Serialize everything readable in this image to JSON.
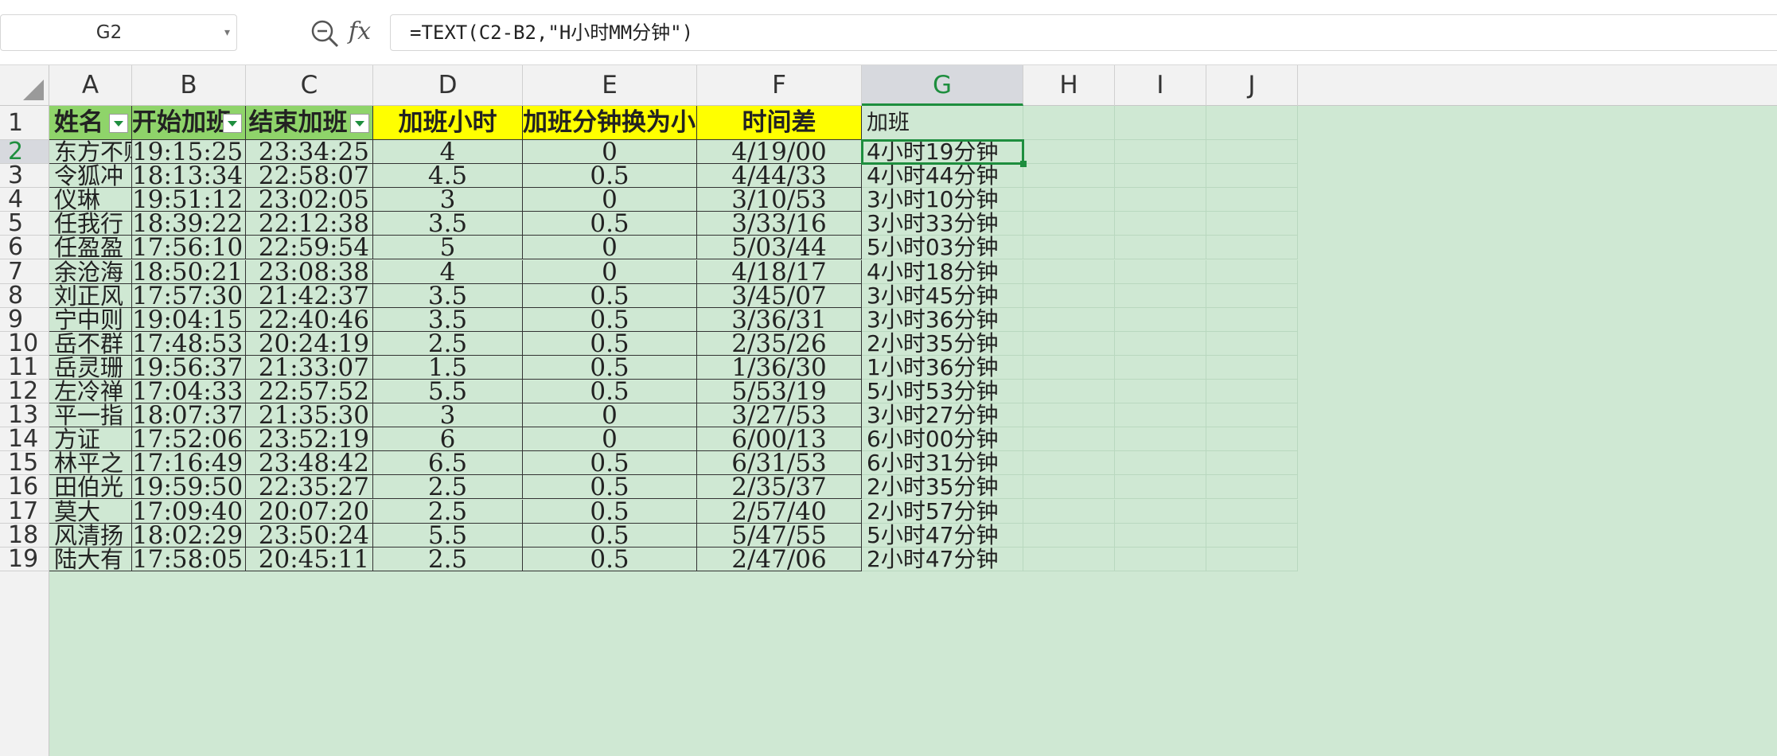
{
  "formula_bar": {
    "cell_ref": "G2",
    "formula": "=TEXT(C2-B2,\"H小时MM分钟\")",
    "zoom_icon": "zoom-out-icon",
    "fx_label": "fx"
  },
  "columns": [
    "A",
    "B",
    "C",
    "D",
    "E",
    "F",
    "G",
    "H",
    "I",
    "J"
  ],
  "active_column": "G",
  "active_row": 2,
  "headers": [
    "姓名",
    "开始加班",
    "结束加班",
    "加班小时",
    "加班分钟换为小时",
    "时间差",
    "加班"
  ],
  "rows": [
    {
      "num": "2",
      "cells": [
        "东方不败",
        "19:15:25",
        "23:34:25",
        "4",
        "0",
        "4/19/00",
        "4小时19分钟"
      ]
    },
    {
      "num": "3",
      "cells": [
        "令狐冲",
        "18:13:34",
        "22:58:07",
        "4.5",
        "0.5",
        "4/44/33",
        "4小时44分钟"
      ]
    },
    {
      "num": "4",
      "cells": [
        "仪琳",
        "19:51:12",
        "23:02:05",
        "3",
        "0",
        "3/10/53",
        "3小时10分钟"
      ]
    },
    {
      "num": "5",
      "cells": [
        "任我行",
        "18:39:22",
        "22:12:38",
        "3.5",
        "0.5",
        "3/33/16",
        "3小时33分钟"
      ]
    },
    {
      "num": "6",
      "cells": [
        "任盈盈",
        "17:56:10",
        "22:59:54",
        "5",
        "0",
        "5/03/44",
        "5小时03分钟"
      ]
    },
    {
      "num": "7",
      "cells": [
        "余沧海",
        "18:50:21",
        "23:08:38",
        "4",
        "0",
        "4/18/17",
        "4小时18分钟"
      ]
    },
    {
      "num": "8",
      "cells": [
        "刘正风",
        "17:57:30",
        "21:42:37",
        "3.5",
        "0.5",
        "3/45/07",
        "3小时45分钟"
      ]
    },
    {
      "num": "9",
      "cells": [
        "宁中则",
        "19:04:15",
        "22:40:46",
        "3.5",
        "0.5",
        "3/36/31",
        "3小时36分钟"
      ]
    },
    {
      "num": "10",
      "cells": [
        "岳不群",
        "17:48:53",
        "20:24:19",
        "2.5",
        "0.5",
        "2/35/26",
        "2小时35分钟"
      ]
    },
    {
      "num": "11",
      "cells": [
        "岳灵珊",
        "19:56:37",
        "21:33:07",
        "1.5",
        "0.5",
        "1/36/30",
        "1小时36分钟"
      ]
    },
    {
      "num": "12",
      "cells": [
        "左冷禅",
        "17:04:33",
        "22:57:52",
        "5.5",
        "0.5",
        "5/53/19",
        "5小时53分钟"
      ]
    },
    {
      "num": "13",
      "cells": [
        "平一指",
        "18:07:37",
        "21:35:30",
        "3",
        "0",
        "3/27/53",
        "3小时27分钟"
      ]
    },
    {
      "num": "14",
      "cells": [
        "方证",
        "17:52:06",
        "23:52:19",
        "6",
        "0",
        "6/00/13",
        "6小时00分钟"
      ]
    },
    {
      "num": "15",
      "cells": [
        "林平之",
        "17:16:49",
        "23:48:42",
        "6.5",
        "0.5",
        "6/31/53",
        "6小时31分钟"
      ]
    },
    {
      "num": "16",
      "cells": [
        "田伯光",
        "19:59:50",
        "22:35:27",
        "2.5",
        "0.5",
        "2/35/37",
        "2小时35分钟"
      ]
    },
    {
      "num": "17",
      "cells": [
        "莫大",
        "17:09:40",
        "20:07:20",
        "2.5",
        "0.5",
        "2/57/40",
        "2小时57分钟"
      ]
    },
    {
      "num": "18",
      "cells": [
        "风清扬",
        "18:02:29",
        "23:50:24",
        "5.5",
        "0.5",
        "5/47/55",
        "5小时47分钟"
      ]
    },
    {
      "num": "19",
      "cells": [
        "陆大有",
        "17:58:05",
        "20:45:11",
        "2.5",
        "0.5",
        "2/47/06",
        "2小时47分钟"
      ]
    }
  ],
  "colors": {
    "header_green": "#8fd46a",
    "header_yellow": "#ffff00",
    "sheet_background": "#cfe8d3",
    "selection": "#1e8e3e"
  }
}
